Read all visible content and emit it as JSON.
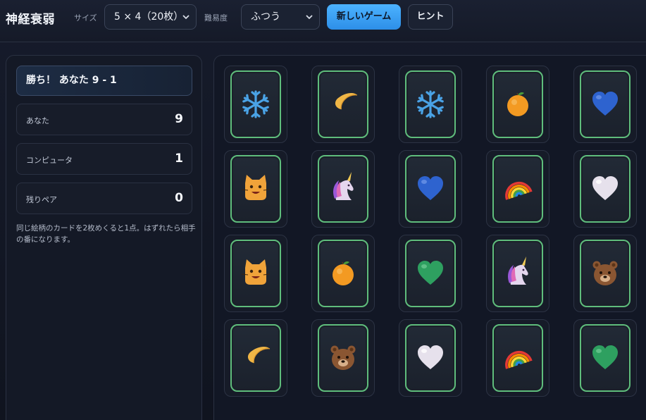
{
  "header": {
    "title": "神経衰弱",
    "size_label": "サイズ",
    "size_value": "5 × 4（20枚）",
    "difficulty_label": "難易度",
    "difficulty_value": "ふつう",
    "new_game_label": "新しいゲーム",
    "hint_label": "ヒント"
  },
  "side": {
    "status": "勝ち！ あなた 9 - 1",
    "scores": [
      {
        "label": "あなた",
        "value": "9"
      },
      {
        "label": "コンピュータ",
        "value": "1"
      },
      {
        "label": "残りペア",
        "value": "0"
      }
    ],
    "rules": "同じ絵柄のカードを2枚めくると1点。はずれたら相手の番になります。"
  },
  "board": {
    "cards": [
      "snowflake",
      "crescent-moon",
      "snowflake",
      "orange",
      "blue-heart",
      "cat",
      "unicorn",
      "blue-heart",
      "rainbow",
      "white-heart",
      "cat",
      "orange",
      "green-heart",
      "unicorn",
      "bear",
      "crescent-moon",
      "bear",
      "white-heart",
      "rainbow",
      "green-heart"
    ]
  },
  "colors": {
    "accent": "#3ea0f5",
    "card_border": "#5fbd7c"
  }
}
